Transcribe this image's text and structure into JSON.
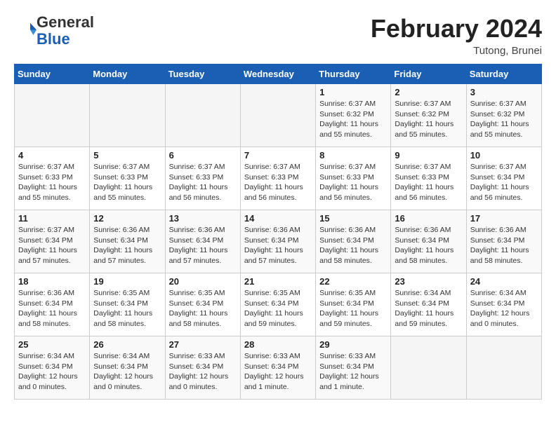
{
  "header": {
    "logo_line1": "General",
    "logo_line2": "Blue",
    "month": "February 2024",
    "location": "Tutong, Brunei"
  },
  "weekdays": [
    "Sunday",
    "Monday",
    "Tuesday",
    "Wednesday",
    "Thursday",
    "Friday",
    "Saturday"
  ],
  "weeks": [
    [
      {
        "day": "",
        "info": ""
      },
      {
        "day": "",
        "info": ""
      },
      {
        "day": "",
        "info": ""
      },
      {
        "day": "",
        "info": ""
      },
      {
        "day": "1",
        "info": "Sunrise: 6:37 AM\nSunset: 6:32 PM\nDaylight: 11 hours\nand 55 minutes."
      },
      {
        "day": "2",
        "info": "Sunrise: 6:37 AM\nSunset: 6:32 PM\nDaylight: 11 hours\nand 55 minutes."
      },
      {
        "day": "3",
        "info": "Sunrise: 6:37 AM\nSunset: 6:32 PM\nDaylight: 11 hours\nand 55 minutes."
      }
    ],
    [
      {
        "day": "4",
        "info": "Sunrise: 6:37 AM\nSunset: 6:33 PM\nDaylight: 11 hours\nand 55 minutes."
      },
      {
        "day": "5",
        "info": "Sunrise: 6:37 AM\nSunset: 6:33 PM\nDaylight: 11 hours\nand 55 minutes."
      },
      {
        "day": "6",
        "info": "Sunrise: 6:37 AM\nSunset: 6:33 PM\nDaylight: 11 hours\nand 56 minutes."
      },
      {
        "day": "7",
        "info": "Sunrise: 6:37 AM\nSunset: 6:33 PM\nDaylight: 11 hours\nand 56 minutes."
      },
      {
        "day": "8",
        "info": "Sunrise: 6:37 AM\nSunset: 6:33 PM\nDaylight: 11 hours\nand 56 minutes."
      },
      {
        "day": "9",
        "info": "Sunrise: 6:37 AM\nSunset: 6:33 PM\nDaylight: 11 hours\nand 56 minutes."
      },
      {
        "day": "10",
        "info": "Sunrise: 6:37 AM\nSunset: 6:34 PM\nDaylight: 11 hours\nand 56 minutes."
      }
    ],
    [
      {
        "day": "11",
        "info": "Sunrise: 6:37 AM\nSunset: 6:34 PM\nDaylight: 11 hours\nand 57 minutes."
      },
      {
        "day": "12",
        "info": "Sunrise: 6:36 AM\nSunset: 6:34 PM\nDaylight: 11 hours\nand 57 minutes."
      },
      {
        "day": "13",
        "info": "Sunrise: 6:36 AM\nSunset: 6:34 PM\nDaylight: 11 hours\nand 57 minutes."
      },
      {
        "day": "14",
        "info": "Sunrise: 6:36 AM\nSunset: 6:34 PM\nDaylight: 11 hours\nand 57 minutes."
      },
      {
        "day": "15",
        "info": "Sunrise: 6:36 AM\nSunset: 6:34 PM\nDaylight: 11 hours\nand 58 minutes."
      },
      {
        "day": "16",
        "info": "Sunrise: 6:36 AM\nSunset: 6:34 PM\nDaylight: 11 hours\nand 58 minutes."
      },
      {
        "day": "17",
        "info": "Sunrise: 6:36 AM\nSunset: 6:34 PM\nDaylight: 11 hours\nand 58 minutes."
      }
    ],
    [
      {
        "day": "18",
        "info": "Sunrise: 6:36 AM\nSunset: 6:34 PM\nDaylight: 11 hours\nand 58 minutes."
      },
      {
        "day": "19",
        "info": "Sunrise: 6:35 AM\nSunset: 6:34 PM\nDaylight: 11 hours\nand 58 minutes."
      },
      {
        "day": "20",
        "info": "Sunrise: 6:35 AM\nSunset: 6:34 PM\nDaylight: 11 hours\nand 58 minutes."
      },
      {
        "day": "21",
        "info": "Sunrise: 6:35 AM\nSunset: 6:34 PM\nDaylight: 11 hours\nand 59 minutes."
      },
      {
        "day": "22",
        "info": "Sunrise: 6:35 AM\nSunset: 6:34 PM\nDaylight: 11 hours\nand 59 minutes."
      },
      {
        "day": "23",
        "info": "Sunrise: 6:34 AM\nSunset: 6:34 PM\nDaylight: 11 hours\nand 59 minutes."
      },
      {
        "day": "24",
        "info": "Sunrise: 6:34 AM\nSunset: 6:34 PM\nDaylight: 12 hours\nand 0 minutes."
      }
    ],
    [
      {
        "day": "25",
        "info": "Sunrise: 6:34 AM\nSunset: 6:34 PM\nDaylight: 12 hours\nand 0 minutes."
      },
      {
        "day": "26",
        "info": "Sunrise: 6:34 AM\nSunset: 6:34 PM\nDaylight: 12 hours\nand 0 minutes."
      },
      {
        "day": "27",
        "info": "Sunrise: 6:33 AM\nSunset: 6:34 PM\nDaylight: 12 hours\nand 0 minutes."
      },
      {
        "day": "28",
        "info": "Sunrise: 6:33 AM\nSunset: 6:34 PM\nDaylight: 12 hours\nand 1 minute."
      },
      {
        "day": "29",
        "info": "Sunrise: 6:33 AM\nSunset: 6:34 PM\nDaylight: 12 hours\nand 1 minute."
      },
      {
        "day": "",
        "info": ""
      },
      {
        "day": "",
        "info": ""
      }
    ]
  ]
}
